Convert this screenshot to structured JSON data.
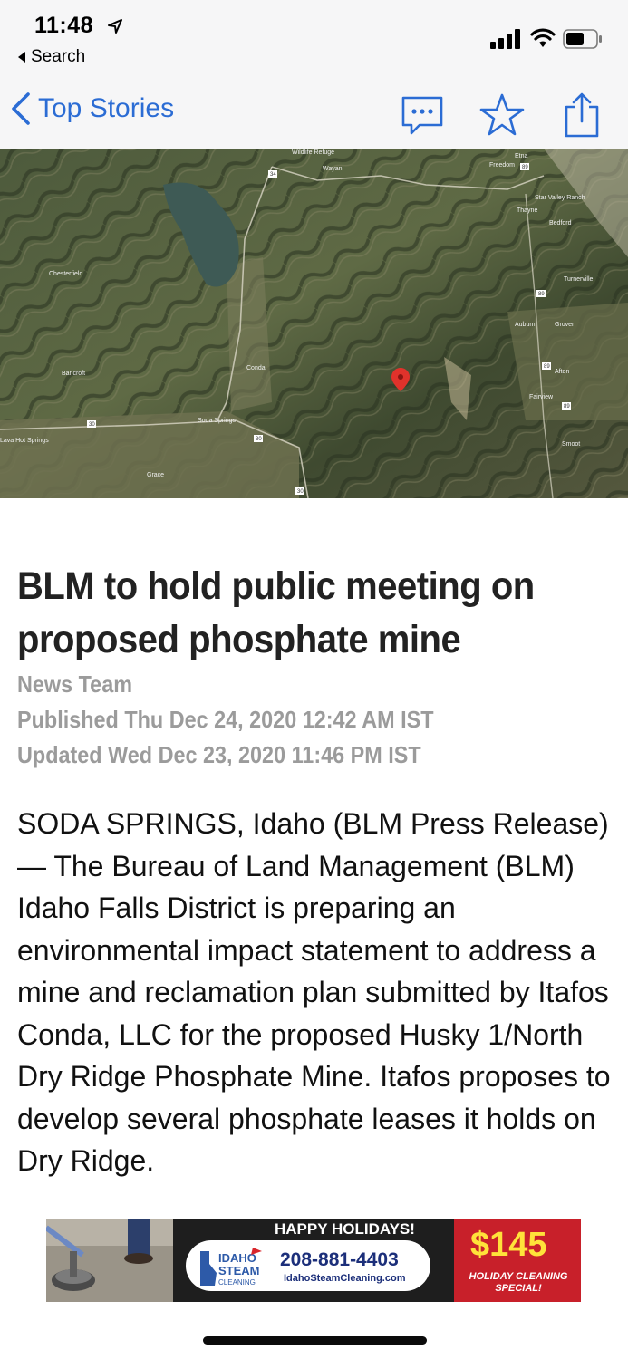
{
  "status_bar": {
    "time": "11:48",
    "back_label": "Search"
  },
  "nav": {
    "back_label": "Top Stories",
    "icons": [
      "comment-icon",
      "star-icon",
      "share-icon"
    ],
    "accent_color": "#2b6cd4"
  },
  "map": {
    "place_labels": [
      "Wildlife Refuge",
      "Wayan",
      "Freedom",
      "Star Valley Ranch",
      "Etna",
      "Thayne",
      "Bedford",
      "Turnerville",
      "Chesterfield",
      "Auburn",
      "Grover",
      "Afton",
      "Fairview",
      "Bancroft",
      "Conda",
      "Soda Springs",
      "Lava Hot Springs",
      "Smoot",
      "Grace"
    ],
    "road_numbers": [
      "89",
      "34",
      "30",
      "30",
      "89",
      "89",
      "89",
      "30"
    ]
  },
  "article": {
    "headline": "BLM to hold public meeting on proposed phosphate mine",
    "author": "News Team",
    "published": "Published Thu Dec 24, 2020 12:42 AM IST",
    "updated": "Updated Wed Dec 23, 2020 11:46 PM IST",
    "body": "SODA SPRINGS, Idaho (BLM Press Release) — The Bureau of Land Management (BLM) Idaho Falls District is preparing an environmental impact statement to address a mine and reclamation plan submitted by Itafos Conda, LLC for the proposed Husky 1/North Dry Ridge Phosphate Mine. Itafos proposes to develop several phosphate leases it holds on Dry Ridge."
  },
  "ad": {
    "headline": "HAPPY HOLIDAYS!",
    "logo_text": [
      "IDAHO",
      "STEAM",
      "CLEANING"
    ],
    "phone": "208-881-4403",
    "url": "IdahoSteamCleaning.com",
    "price": "$145",
    "offer_line1": "HOLIDAY CLEANING",
    "offer_line2": "SPECIAL!"
  }
}
